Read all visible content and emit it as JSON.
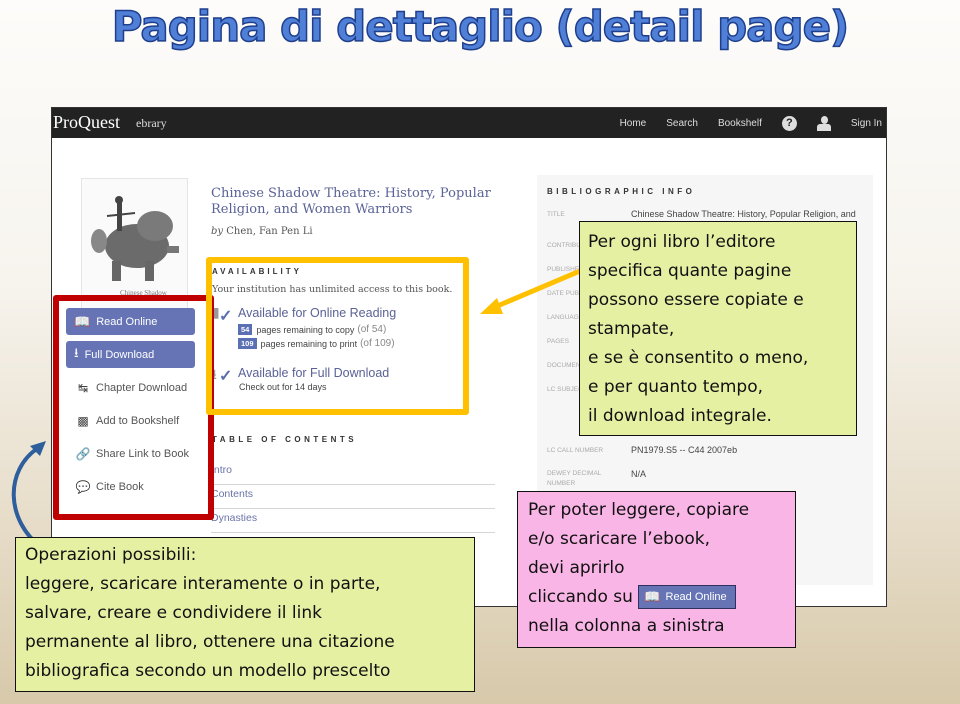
{
  "slide": {
    "title": "Pagina di dettaglio (detail page)"
  },
  "app": {
    "logo": "ProQuest",
    "logo_sub": "ebrary",
    "nav": {
      "home": "Home",
      "search": "Search",
      "bookshelf": "Bookshelf",
      "help_icon": "?",
      "user_icon": "user-icon",
      "sign_in": "Sign In"
    },
    "book": {
      "cover_caption": "Chinese Shadow",
      "title": "Chinese Shadow Theatre: History, Popular Religion, and Women Warriors",
      "author_prefix": "by",
      "author": "Chen, Fan Pen Li"
    },
    "actions": {
      "read_online": "Read Online",
      "full_download": "Full Download",
      "chapter_download": "Chapter Download",
      "add_to_bookshelf": "Add to Bookshelf",
      "share_link": "Share Link to Book",
      "cite_book": "Cite Book"
    },
    "availability": {
      "label": "AVAILABILITY",
      "note": "Your institution has unlimited access to this book.",
      "online_reading": "Available for Online Reading",
      "copy_count": "54",
      "copy_text": "pages remaining to copy",
      "copy_of": "(of 54)",
      "print_count": "109",
      "print_text": "pages remaining to print",
      "print_of": "(of 109)",
      "full_download": "Available for Full Download",
      "checkout": "Check out for 14 days"
    },
    "toc": {
      "label": "TABLE OF CONTENTS",
      "items": [
        "Intro",
        "Contents",
        "Dynasties"
      ]
    },
    "biblio": {
      "label": "BIBLIOGRAPHIC INFO",
      "rows": [
        {
          "label": "TITLE",
          "value": "Chinese Shadow Theatre: History, Popular Religion, and Women Warriors"
        },
        {
          "label": "CONTRIBUTORS",
          "value": ""
        },
        {
          "label": "PUBLISHER",
          "value": ""
        },
        {
          "label": "DATE PUBLISHED",
          "value": ""
        },
        {
          "label": "LANGUAGE",
          "value": ""
        },
        {
          "label": "PAGES",
          "value": ""
        },
        {
          "label": "DOCUMENT TYPE",
          "value": ""
        },
        {
          "label": "LC SUBJECT HEADINGS",
          "value": ""
        },
        {
          "label": "LC CALL NUMBER",
          "value": "PN1979.S5 -- C44 2007eb"
        },
        {
          "label": "DEWEY DECIMAL NUMBER",
          "value": "N/A"
        }
      ]
    }
  },
  "callouts": {
    "pages_info": [
      "Per ogni libro l’editore",
      "specifica quante pagine",
      "possono essere copiate e",
      "stampate,",
      "e se è consentito o meno,",
      "e per quanto tempo,",
      "il download integrale."
    ],
    "operations": [
      "Operazioni possibili:",
      "leggere, scaricare interamente o in parte,",
      "salvare, creare e condividere il link",
      "permanente al libro, ottenere una citazione",
      "bibliografica secondo un modello prescelto"
    ],
    "open_book": {
      "line1": "Per poter leggere, copiare",
      "line2": "e/o scaricare l’ebook,",
      "line3": "devi aprirlo",
      "line4_prefix": "cliccando su",
      "button_label": "Read Online",
      "line5": "nella colonna a sinistra"
    }
  },
  "colors": {
    "title_blue": "#4f7fd6",
    "button_blue": "#6674b6",
    "red_frame": "#c00000",
    "yellow_frame": "#ffc000",
    "callout_green": "#e6f0a3",
    "callout_pink": "#f9b5e6",
    "arrow_blue": "#2e5e9c"
  }
}
